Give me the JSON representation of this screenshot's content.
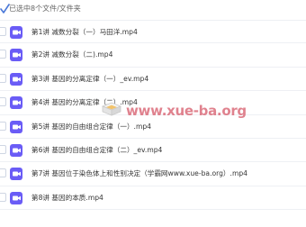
{
  "header": {
    "selection_text": "已选中8个文件/文件夹"
  },
  "files": [
    {
      "name": "第1讲 减数分裂（一）马田洋.mp4",
      "icon": "video-file-icon"
    },
    {
      "name": "第2讲 减数分裂（二).mp4",
      "icon": "video-file-icon"
    },
    {
      "name": "第3讲 基因的分离定律（一）_ev.mp4",
      "icon": "video-file-icon"
    },
    {
      "name": "第4讲 基因的分离定律（二）.mp4",
      "icon": "video-file-icon"
    },
    {
      "name": "第5讲 基因的自由组合定律（一）.mp4",
      "icon": "video-file-icon"
    },
    {
      "name": "第6讲 基因的自由组合定律（二）_ev.mp4",
      "icon": "video-file-icon"
    },
    {
      "name": "第7讲 基因位于染色体上和性别决定（学霸网www.xue-ba.org）.mp4",
      "icon": "video-file-icon"
    },
    {
      "name": "第8讲 基因的本质.mp4",
      "icon": "video-file-icon"
    }
  ],
  "watermark": {
    "text": "www.xue-ba.org"
  },
  "colors": {
    "file_icon": "#6a5cf6",
    "watermark": "#d75f6e",
    "row_border": "#eef0f4"
  }
}
